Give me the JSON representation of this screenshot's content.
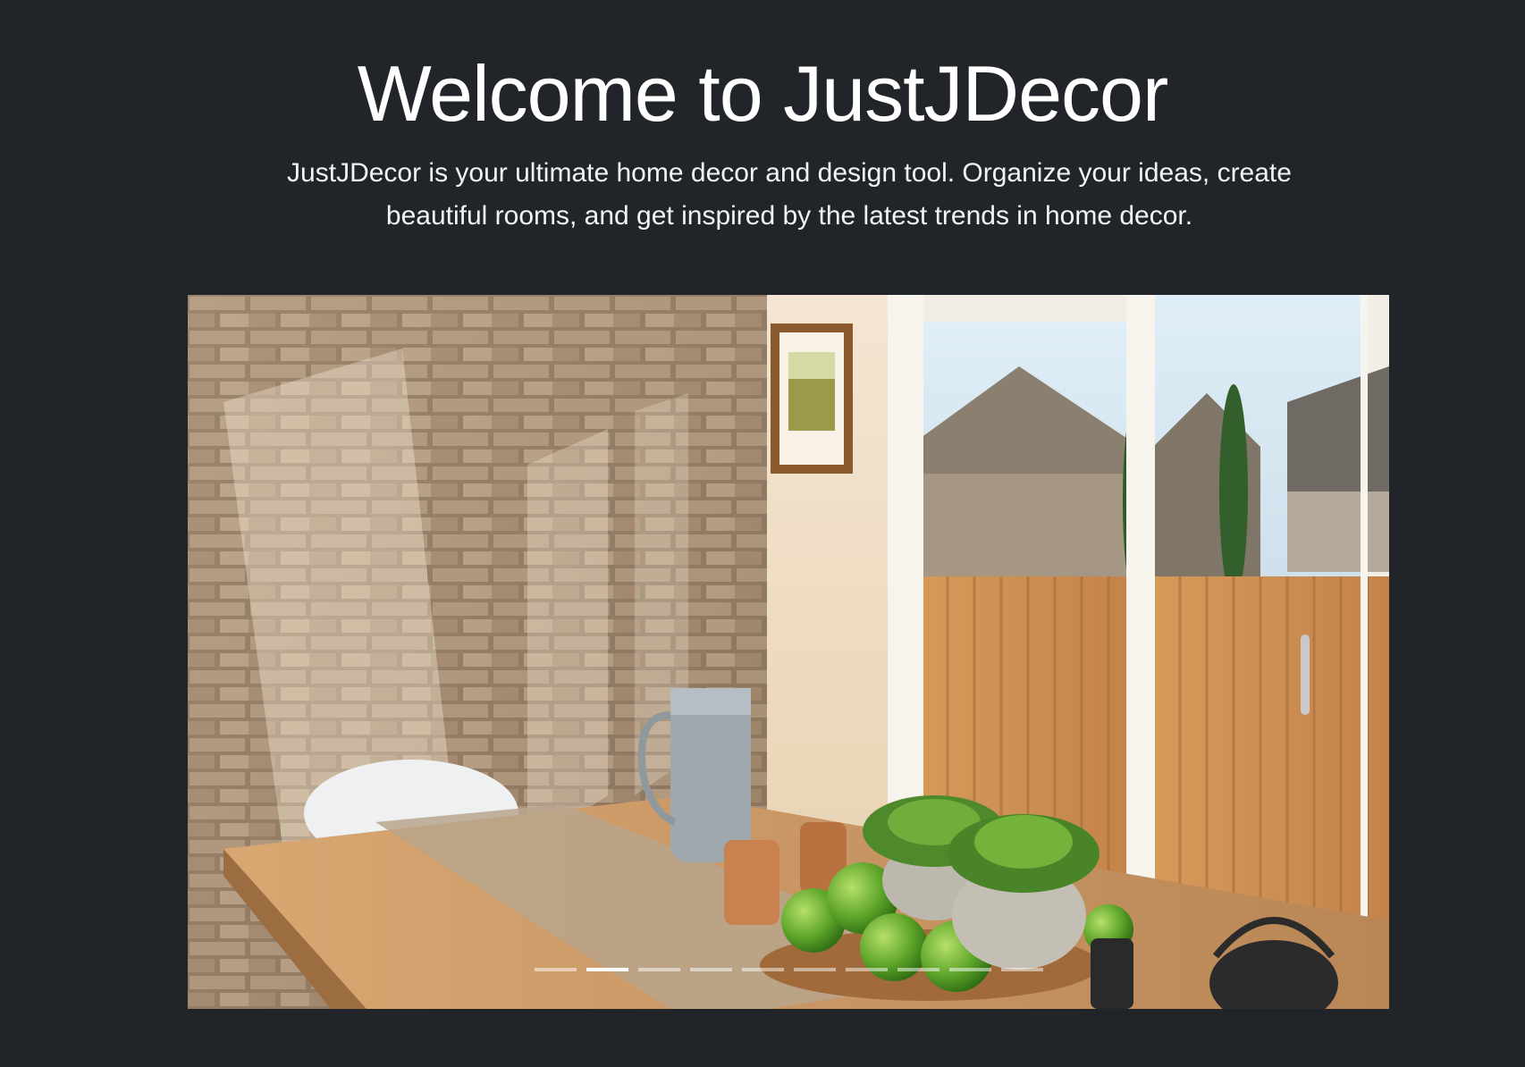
{
  "hero": {
    "title": "Welcome to JustJDecor",
    "lead": "JustJDecor is your ultimate home decor and design tool. Organize your ideas, create beautiful rooms, and get inspired by the latest trends in home decor."
  },
  "carousel": {
    "slide_count": 10,
    "active_index": 1,
    "image_subject": "dining room with brick wall, wooden table, green apples, succulents and sliding glass door"
  },
  "colors": {
    "background": "#212529",
    "text": "#ffffff",
    "indicator_active": "#ffffff",
    "indicator_inactive": "rgba(255,255,255,0.5)"
  }
}
